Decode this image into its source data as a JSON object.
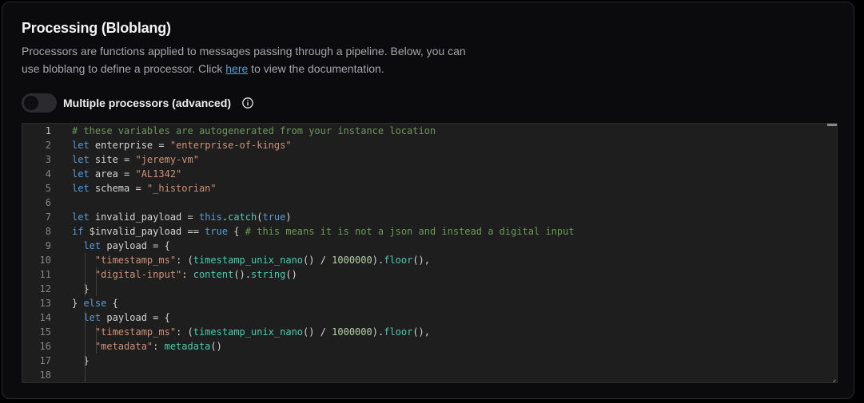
{
  "section": {
    "title": "Processing (Bloblang)",
    "description_before_link": "Processors are functions applied to messages passing through a pipeline. Below, you can use bloblang to define a processor. Click ",
    "link_text": "here",
    "description_after_link": " to view the documentation."
  },
  "toggle": {
    "label": "Multiple processors (advanced)",
    "enabled": false,
    "info_icon": "info-circle-icon"
  },
  "editor": {
    "active_line": 1,
    "lines": [
      [
        [
          "cm",
          "# these variables are autogenerated from your instance location"
        ]
      ],
      [
        [
          "kw",
          "let"
        ],
        [
          "",
          " enterprise = "
        ],
        [
          "str",
          "\"enterprise-of-kings\""
        ]
      ],
      [
        [
          "kw",
          "let"
        ],
        [
          "",
          " site = "
        ],
        [
          "str",
          "\"jeremy-vm\""
        ]
      ],
      [
        [
          "kw",
          "let"
        ],
        [
          "",
          " area = "
        ],
        [
          "str",
          "\"AL1342\""
        ]
      ],
      [
        [
          "kw",
          "let"
        ],
        [
          "",
          " schema = "
        ],
        [
          "str",
          "\"_historian\""
        ]
      ],
      [],
      [
        [
          "kw",
          "let"
        ],
        [
          "",
          " invalid_payload = "
        ],
        [
          "kw",
          "this"
        ],
        [
          "",
          "."
        ],
        [
          "fn",
          "catch"
        ],
        [
          "",
          "("
        ],
        [
          "kw",
          "true"
        ],
        [
          "",
          ")"
        ]
      ],
      [
        [
          "kw",
          "if"
        ],
        [
          "",
          " $invalid_payload == "
        ],
        [
          "kw",
          "true"
        ],
        [
          "",
          " { "
        ],
        [
          "cm",
          "# this means it is not a json and instead a digital input"
        ]
      ],
      [
        [
          "",
          "  "
        ],
        [
          "kw",
          "let"
        ],
        [
          "",
          " payload = {"
        ]
      ],
      [
        [
          "",
          "    "
        ],
        [
          "str",
          "\"timestamp_ms\""
        ],
        [
          "",
          ": ("
        ],
        [
          "fn",
          "timestamp_unix_nano"
        ],
        [
          "",
          "() / "
        ],
        [
          "num",
          "1000000"
        ],
        [
          "",
          ")."
        ],
        [
          "fn",
          "floor"
        ],
        [
          "",
          "(),"
        ]
      ],
      [
        [
          "",
          "    "
        ],
        [
          "str",
          "\"digital-input\""
        ],
        [
          "",
          ": "
        ],
        [
          "fn",
          "content"
        ],
        [
          "",
          "()."
        ],
        [
          "fn",
          "string"
        ],
        [
          "",
          "()"
        ]
      ],
      [
        [
          "",
          "  }"
        ]
      ],
      [
        [
          "",
          "} "
        ],
        [
          "kw",
          "else"
        ],
        [
          "",
          " {"
        ]
      ],
      [
        [
          "",
          "  "
        ],
        [
          "kw",
          "let"
        ],
        [
          "",
          " payload = {"
        ]
      ],
      [
        [
          "",
          "    "
        ],
        [
          "str",
          "\"timestamp_ms\""
        ],
        [
          "",
          ": ("
        ],
        [
          "fn",
          "timestamp_unix_nano"
        ],
        [
          "",
          "() / "
        ],
        [
          "num",
          "1000000"
        ],
        [
          "",
          ")."
        ],
        [
          "fn",
          "floor"
        ],
        [
          "",
          "(),"
        ]
      ],
      [
        [
          "",
          "    "
        ],
        [
          "str",
          "\"metadata\""
        ],
        [
          "",
          ": "
        ],
        [
          "fn",
          "metadata"
        ],
        [
          "",
          "()"
        ]
      ],
      [
        [
          "",
          "  }"
        ]
      ],
      []
    ]
  }
}
